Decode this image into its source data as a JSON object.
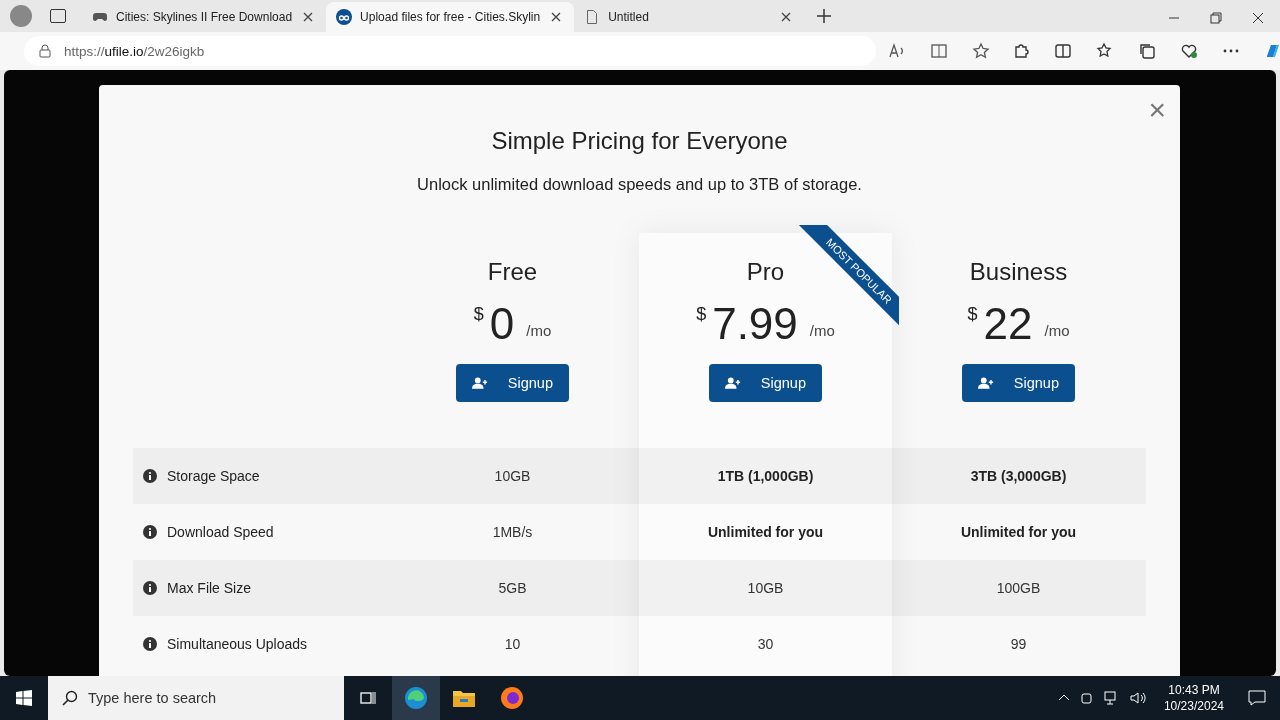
{
  "browser": {
    "tabs": [
      {
        "kind": "game",
        "title": "Cities: Skylines II Free Download",
        "selected": false
      },
      {
        "kind": "site",
        "title": "Upload files for free - Cities.Skylin",
        "selected": true
      },
      {
        "kind": "blank",
        "title": "Untitled",
        "selected": false
      }
    ],
    "address": {
      "scheme": "https://",
      "host": "ufile.io",
      "path": "/2w26igkb"
    }
  },
  "modal": {
    "close": "×",
    "title": "Simple Pricing for Everyone",
    "subtitle": "Unlock unlimited download speeds and up to 3TB of storage.",
    "plans": [
      {
        "name": "Free",
        "currency": "$",
        "price": "0",
        "period": "/mo",
        "button": "Signup",
        "featured": false
      },
      {
        "name": "Pro",
        "currency": "$",
        "price": "7.99",
        "period": "/mo",
        "button": "Signup",
        "featured": true,
        "ribbon": "MOST POPULAR"
      },
      {
        "name": "Business",
        "currency": "$",
        "price": "22",
        "period": "/mo",
        "button": "Signup",
        "featured": false
      }
    ],
    "features": [
      {
        "label": "Storage Space",
        "values": [
          {
            "text": "10GB",
            "bold": false
          },
          {
            "text": "1TB (1,000GB)",
            "bold": true
          },
          {
            "text": "3TB (3,000GB)",
            "bold": true
          }
        ]
      },
      {
        "label": "Download Speed",
        "values": [
          {
            "text": "1MB/s",
            "bold": false
          },
          {
            "text": "Unlimited for you",
            "bold": true
          },
          {
            "text": "Unlimited for you",
            "bold": true
          }
        ]
      },
      {
        "label": "Max File Size",
        "values": [
          {
            "text": "5GB",
            "bold": false
          },
          {
            "text": "10GB",
            "bold": false
          },
          {
            "text": "100GB",
            "bold": false
          }
        ]
      },
      {
        "label": "Simultaneous Uploads",
        "values": [
          {
            "text": "10",
            "bold": false
          },
          {
            "text": "30",
            "bold": false
          },
          {
            "text": "99",
            "bold": false
          }
        ]
      }
    ]
  },
  "taskbar": {
    "search": {
      "placeholder": "Type here to search"
    },
    "time": "10:43 PM",
    "date": "10/23/2024"
  }
}
